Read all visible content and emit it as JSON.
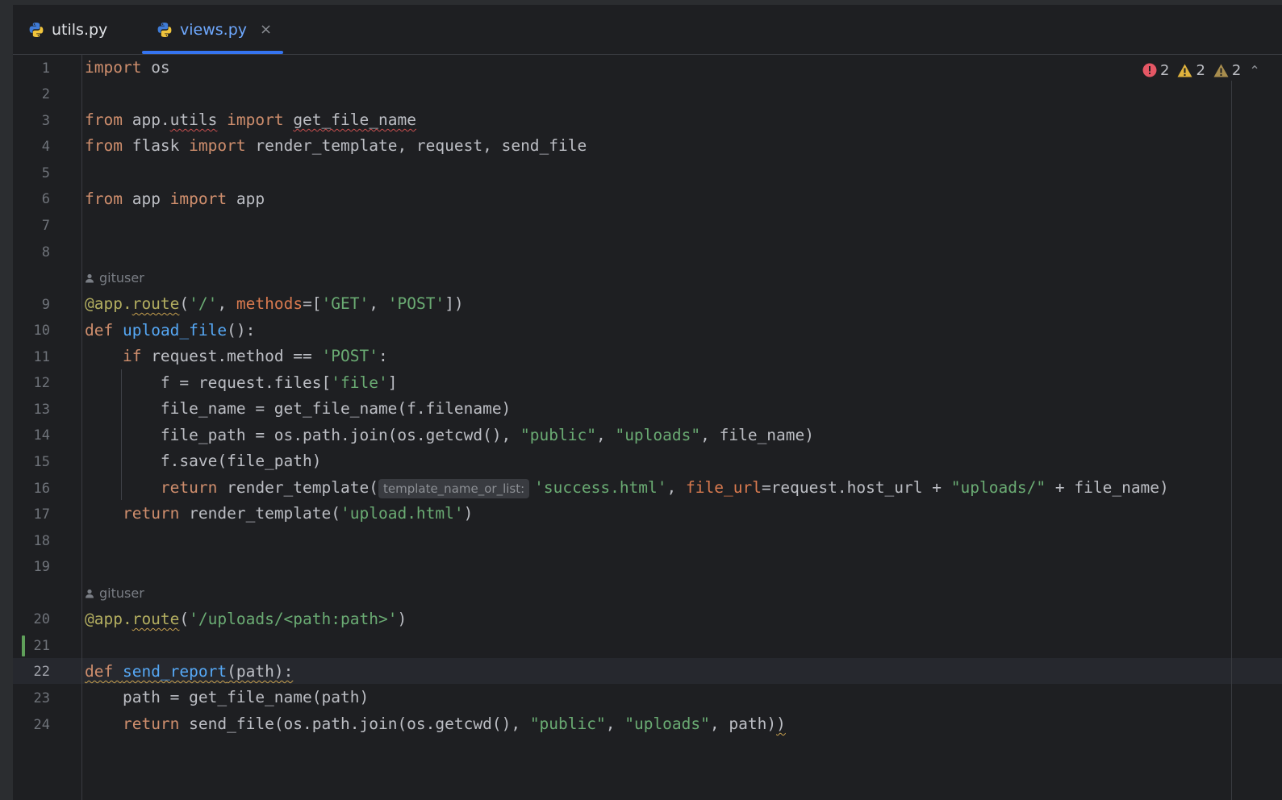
{
  "tabs": [
    {
      "label": "utils.py",
      "active": false
    },
    {
      "label": "views.py",
      "active": true,
      "close_symbol": "×"
    }
  ],
  "inspections": {
    "errors": "2",
    "warnings": "2",
    "weak_warnings": "2"
  },
  "author": "gituser",
  "line_numbers": [
    "1",
    "2",
    "3",
    "4",
    "5",
    "6",
    "7",
    "8",
    "9",
    "10",
    "11",
    "12",
    "13",
    "14",
    "15",
    "16",
    "17",
    "18",
    "19",
    "20",
    "21",
    "22",
    "23",
    "24"
  ],
  "current_line": "22",
  "inlay_hint": "template_name_or_list:",
  "colors": {
    "background": "#1e1f22",
    "keyword": "#cf8e6d",
    "function": "#56a8f5",
    "string": "#6aab73",
    "decorator": "#b3ae60",
    "accent": "#3574f0",
    "error": "#e55765",
    "warning": "#e0b33d"
  },
  "code": {
    "l1": {
      "k1": "import",
      "t1": " os"
    },
    "l3": {
      "k1": "from",
      "t1": " app.",
      "t2": "utils",
      "k2": " import",
      "t3": " ",
      "t4": "get_file_name"
    },
    "l4": {
      "k1": "from",
      "t1": " flask ",
      "k2": "import",
      "t2": " render_template, request, send_file"
    },
    "l6": {
      "k1": "from",
      "t1": " app ",
      "k2": "import",
      "t2": " app"
    },
    "l9": {
      "d1": "@app.",
      "d2": "route",
      "t1": "(",
      "s1": "'/'",
      "t2": ", ",
      "p1": "methods",
      "t3": "=[",
      "s2": "'GET'",
      "t4": ", ",
      "s3": "'POST'",
      "t5": "])"
    },
    "l10": {
      "k1": "def",
      "t1": " ",
      "f1": "upload_file",
      "t2": "():"
    },
    "l11": {
      "t0": "    ",
      "k1": "if",
      "t1": " request.method == ",
      "s1": "'POST'",
      "t2": ":"
    },
    "l12": {
      "t0": "        f = request.files[",
      "s1": "'file'",
      "t1": "]"
    },
    "l13": {
      "t0": "        file_name = get_file_name(f.filename)"
    },
    "l14": {
      "t0": "        file_path = os.path.join(os.getcwd(), ",
      "s1": "\"public\"",
      "t1": ", ",
      "s2": "\"uploads\"",
      "t2": ", file_name)"
    },
    "l15": {
      "t0": "        f.save(file_path)"
    },
    "l16": {
      "t0": "        ",
      "k1": "return",
      "t1": " render_template(",
      "s1": "'success.html'",
      "t2": ", ",
      "p1": "file_url",
      "t3": "=request.host_url + ",
      "s2": "\"uploads/\"",
      "t4": " + file_name)"
    },
    "l17": {
      "t0": "    ",
      "k1": "return",
      "t1": " render_template(",
      "s1": "'upload.html'",
      "t2": ")"
    },
    "l20": {
      "d1": "@app.",
      "d2": "route",
      "t1": "(",
      "s1": "'/uploads/<path:path>'",
      "t2": ")"
    },
    "l22": {
      "k1": "def",
      "t1": " ",
      "f1": "send_report",
      "t2": "(path):"
    },
    "l23": {
      "t0": "    path = get_file_name(path)"
    },
    "l24": {
      "t0": "    ",
      "k1": "return",
      "t1": " send_file(os.path.join(os.getcwd(), ",
      "s1": "\"public\"",
      "t2": ", ",
      "s2": "\"uploads\"",
      "t3": ", path)",
      "t4": ")"
    }
  }
}
